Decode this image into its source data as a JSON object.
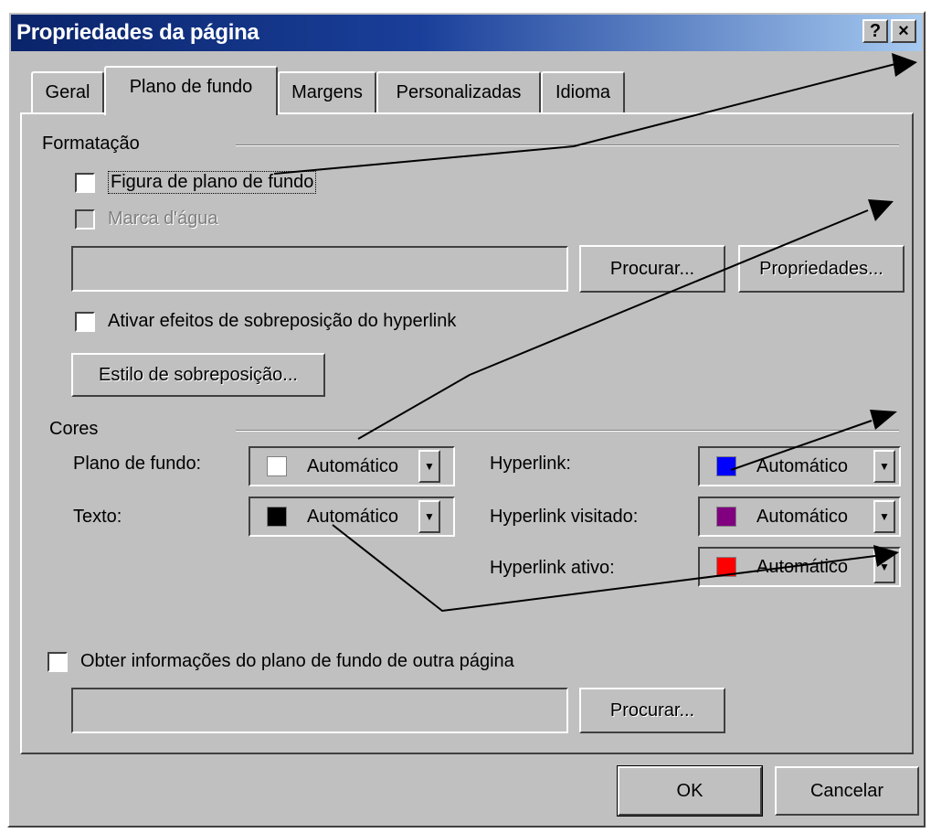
{
  "window": {
    "title": "Propriedades da página",
    "help_btn": "?",
    "close_btn": "×"
  },
  "tabs": [
    {
      "label": "Geral",
      "active": false
    },
    {
      "label": "Plano de fundo",
      "active": true
    },
    {
      "label": "Margens",
      "active": false
    },
    {
      "label": "Personalizadas",
      "active": false
    },
    {
      "label": "Idioma",
      "active": false
    }
  ],
  "formatting": {
    "group_label": "Formatação",
    "background_picture_label": "Figura de plano de fundo",
    "watermark_label": "Marca d'água",
    "path_value": "",
    "browse_button": "Procurar...",
    "properties_button": "Propriedades...",
    "hyperlink_rollover_label": "Ativar efeitos de sobreposição do hyperlink",
    "rollover_style_button": "Estilo de sobreposição..."
  },
  "colors": {
    "group_label": "Cores",
    "background": {
      "label": "Plano de fundo:",
      "value": "Automático",
      "swatch": "#ffffff"
    },
    "text": {
      "label": "Texto:",
      "value": "Automático",
      "swatch": "#000000"
    },
    "hyperlink": {
      "label": "Hyperlink:",
      "value": "Automático",
      "swatch": "#0000ff"
    },
    "hyperlink_visited": {
      "label": "Hyperlink visitado:",
      "value": "Automático",
      "swatch": "#800080"
    },
    "hyperlink_active": {
      "label": "Hyperlink ativo:",
      "value": "Automático",
      "swatch": "#ff0000"
    }
  },
  "other_page": {
    "checkbox_label": "Obter informações do plano de fundo de outra página",
    "path_value": "",
    "browse_button": "Procurar..."
  },
  "footer": {
    "ok_button": "OK",
    "cancel_button": "Cancelar"
  },
  "theme": {
    "face": "#c0c0c0",
    "title_start": "#0a246a",
    "title_end": "#a6caf0",
    "arrow": "#000000"
  }
}
